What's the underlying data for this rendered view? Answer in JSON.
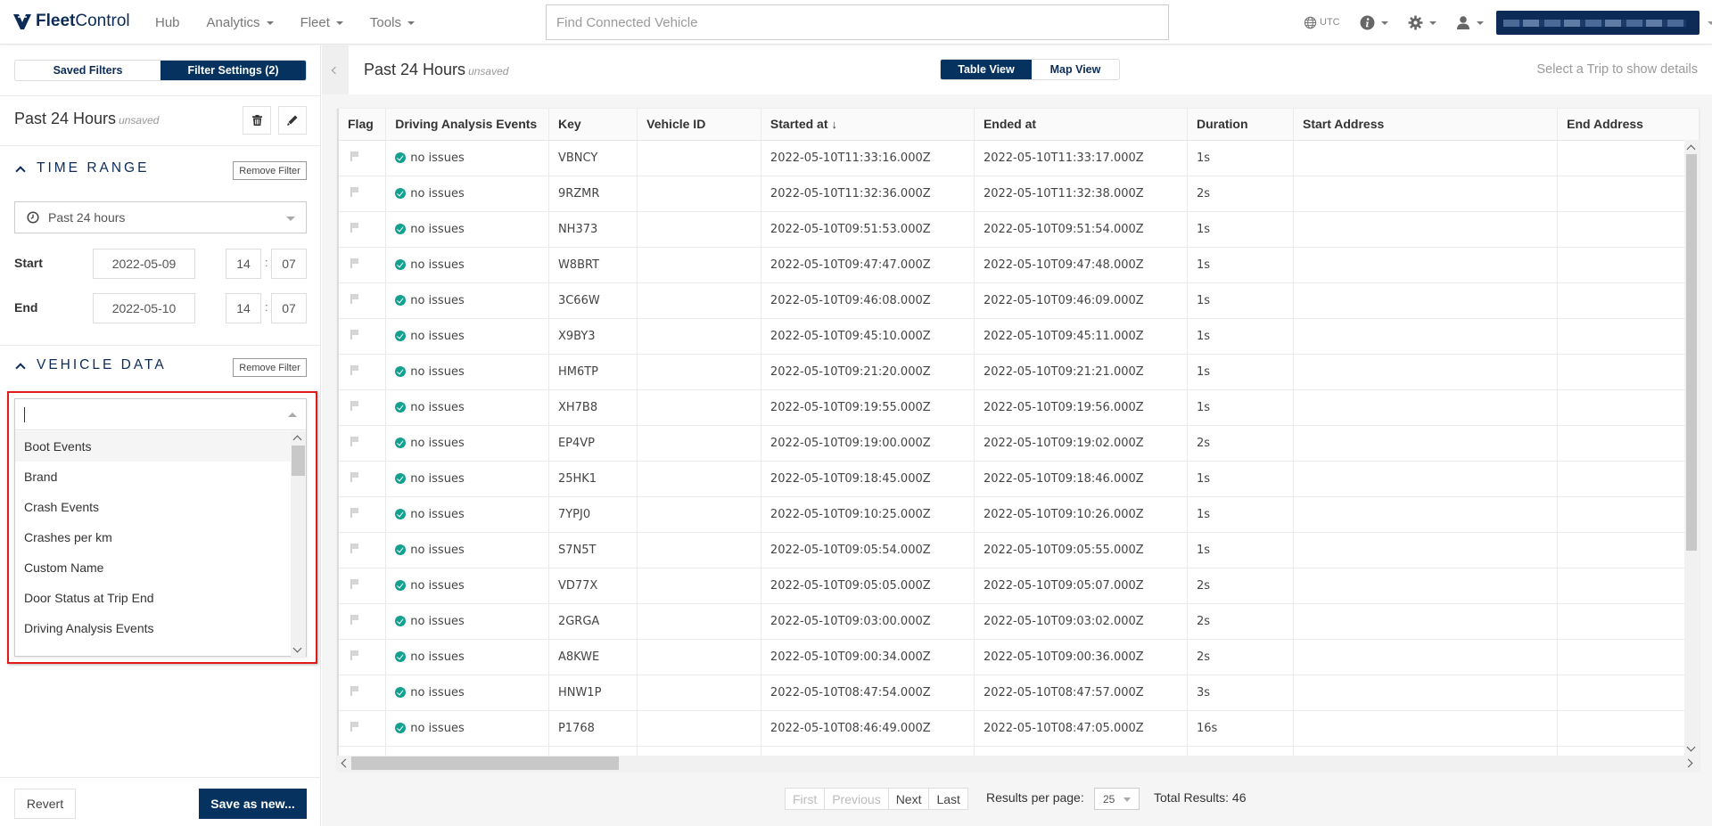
{
  "brand": {
    "name_bold": "Fleet",
    "name_regular": "Control"
  },
  "nav": {
    "links": [
      {
        "label": "Hub",
        "dropdown": false
      },
      {
        "label": "Analytics",
        "dropdown": true
      },
      {
        "label": "Fleet",
        "dropdown": true
      },
      {
        "label": "Tools",
        "dropdown": true
      }
    ],
    "search_placeholder": "Find Connected Vehicle",
    "timezone": "UTC",
    "icons": [
      "globe-icon",
      "info-icon",
      "gear-icon",
      "user-icon"
    ]
  },
  "sidebar": {
    "tabs": [
      {
        "label": "Saved Filters",
        "active": false
      },
      {
        "label": "Filter Settings (2)",
        "active": true
      }
    ],
    "filter_name": "Past 24 Hours",
    "filter_status": "unsaved",
    "time_range": {
      "header": "TIME RANGE",
      "remove_label": "Remove Filter",
      "preset": "Past 24 hours",
      "start_label": "Start",
      "start_date": "2022-05-09",
      "start_hour": "14",
      "start_minute": "07",
      "end_label": "End",
      "end_date": "2022-05-10",
      "end_hour": "14",
      "end_minute": "07",
      "separator": ":"
    },
    "vehicle_data": {
      "header": "VEHICLE DATA",
      "remove_label": "Remove Filter",
      "input_value": "",
      "options": [
        "Boot Events",
        "Brand",
        "Crash Events",
        "Crashes per km",
        "Custom Name",
        "Door Status at Trip End",
        "Driving Analysis Events"
      ],
      "hovered_option": "Boot Events"
    },
    "revert_label": "Revert",
    "save_new_label": "Save as new..."
  },
  "main": {
    "title": "Past 24 Hours",
    "status": "unsaved",
    "views": [
      {
        "label": "Table View",
        "active": true
      },
      {
        "label": "Map View",
        "active": false
      }
    ],
    "hint": "Select a Trip to show details",
    "columns": [
      "Flag",
      "Driving Analysis Events",
      "Key",
      "Vehicle ID",
      "Started at",
      "Ended at",
      "Duration",
      "Start Address",
      "End Address"
    ],
    "sort_column": "Started at",
    "sort_direction": "descending",
    "rows": [
      {
        "status": "no issues",
        "key": "VBNCY",
        "vehicle_id": "",
        "started": "2022-05-10T11:33:16.000Z",
        "ended": "2022-05-10T11:33:17.000Z",
        "duration": "1s",
        "start_address": "",
        "end_address": ""
      },
      {
        "status": "no issues",
        "key": "9RZMR",
        "vehicle_id": "",
        "started": "2022-05-10T11:32:36.000Z",
        "ended": "2022-05-10T11:32:38.000Z",
        "duration": "2s",
        "start_address": "",
        "end_address": ""
      },
      {
        "status": "no issues",
        "key": "NH373",
        "vehicle_id": "",
        "started": "2022-05-10T09:51:53.000Z",
        "ended": "2022-05-10T09:51:54.000Z",
        "duration": "1s",
        "start_address": "",
        "end_address": ""
      },
      {
        "status": "no issues",
        "key": "W8BRT",
        "vehicle_id": "",
        "started": "2022-05-10T09:47:47.000Z",
        "ended": "2022-05-10T09:47:48.000Z",
        "duration": "1s",
        "start_address": "",
        "end_address": ""
      },
      {
        "status": "no issues",
        "key": "3C66W",
        "vehicle_id": "",
        "started": "2022-05-10T09:46:08.000Z",
        "ended": "2022-05-10T09:46:09.000Z",
        "duration": "1s",
        "start_address": "",
        "end_address": ""
      },
      {
        "status": "no issues",
        "key": "X9BY3",
        "vehicle_id": "",
        "started": "2022-05-10T09:45:10.000Z",
        "ended": "2022-05-10T09:45:11.000Z",
        "duration": "1s",
        "start_address": "",
        "end_address": ""
      },
      {
        "status": "no issues",
        "key": "HM6TP",
        "vehicle_id": "",
        "started": "2022-05-10T09:21:20.000Z",
        "ended": "2022-05-10T09:21:21.000Z",
        "duration": "1s",
        "start_address": "",
        "end_address": ""
      },
      {
        "status": "no issues",
        "key": "XH7B8",
        "vehicle_id": "",
        "started": "2022-05-10T09:19:55.000Z",
        "ended": "2022-05-10T09:19:56.000Z",
        "duration": "1s",
        "start_address": "",
        "end_address": ""
      },
      {
        "status": "no issues",
        "key": "EP4VP",
        "vehicle_id": "",
        "started": "2022-05-10T09:19:00.000Z",
        "ended": "2022-05-10T09:19:02.000Z",
        "duration": "2s",
        "start_address": "",
        "end_address": ""
      },
      {
        "status": "no issues",
        "key": "25HK1",
        "vehicle_id": "",
        "started": "2022-05-10T09:18:45.000Z",
        "ended": "2022-05-10T09:18:46.000Z",
        "duration": "1s",
        "start_address": "",
        "end_address": ""
      },
      {
        "status": "no issues",
        "key": "7YPJ0",
        "vehicle_id": "",
        "started": "2022-05-10T09:10:25.000Z",
        "ended": "2022-05-10T09:10:26.000Z",
        "duration": "1s",
        "start_address": "",
        "end_address": ""
      },
      {
        "status": "no issues",
        "key": "S7N5T",
        "vehicle_id": "",
        "started": "2022-05-10T09:05:54.000Z",
        "ended": "2022-05-10T09:05:55.000Z",
        "duration": "1s",
        "start_address": "",
        "end_address": ""
      },
      {
        "status": "no issues",
        "key": "VD77X",
        "vehicle_id": "",
        "started": "2022-05-10T09:05:05.000Z",
        "ended": "2022-05-10T09:05:07.000Z",
        "duration": "2s",
        "start_address": "",
        "end_address": ""
      },
      {
        "status": "no issues",
        "key": "2GRGA",
        "vehicle_id": "",
        "started": "2022-05-10T09:03:00.000Z",
        "ended": "2022-05-10T09:03:02.000Z",
        "duration": "2s",
        "start_address": "",
        "end_address": ""
      },
      {
        "status": "no issues",
        "key": "A8KWE",
        "vehicle_id": "",
        "started": "2022-05-10T09:00:34.000Z",
        "ended": "2022-05-10T09:00:36.000Z",
        "duration": "2s",
        "start_address": "",
        "end_address": ""
      },
      {
        "status": "no issues",
        "key": "HNW1P",
        "vehicle_id": "",
        "started": "2022-05-10T08:47:54.000Z",
        "ended": "2022-05-10T08:47:57.000Z",
        "duration": "3s",
        "start_address": "",
        "end_address": ""
      },
      {
        "status": "no issues",
        "key": "P1768",
        "vehicle_id": "",
        "started": "2022-05-10T08:46:49.000Z",
        "ended": "2022-05-10T08:47:05.000Z",
        "duration": "16s",
        "start_address": "",
        "end_address": ""
      }
    ],
    "pagination": {
      "first": "First",
      "previous": "Previous",
      "next": "Next",
      "last": "Last",
      "first_disabled": true,
      "previous_disabled": true,
      "results_per_page_label": "Results per page:",
      "results_per_page": "25",
      "total_label": "Total Results: 46"
    }
  },
  "colors": {
    "brand_navy": "#05325f",
    "ok_green": "#13a08f",
    "highlight_red": "#e21a1a"
  }
}
